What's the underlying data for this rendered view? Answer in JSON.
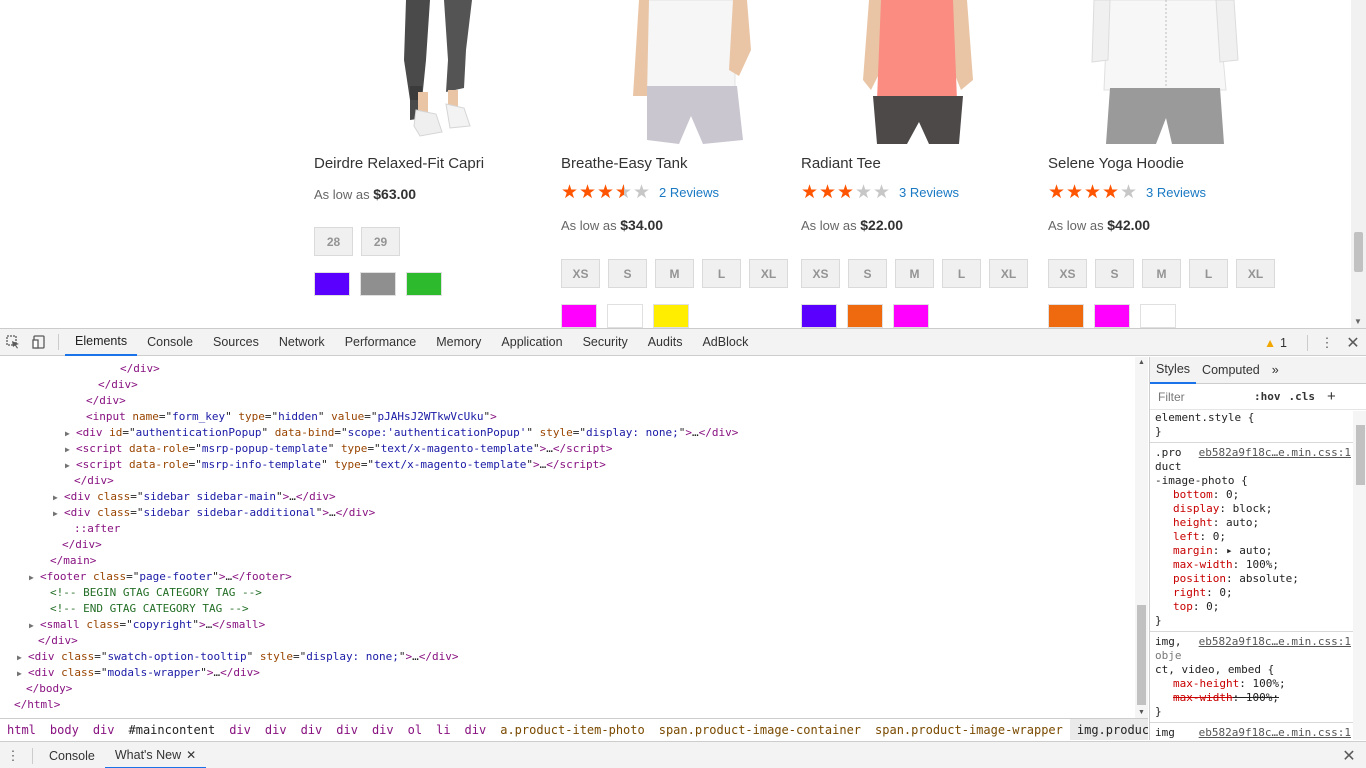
{
  "products": [
    {
      "name": "Deirdre Relaxed-Fit Capri",
      "rating": null,
      "reviews": "",
      "price_label": "As low as",
      "price": "$63.00",
      "sizes": [
        "28",
        "29"
      ],
      "colors": [
        "#5a00ff",
        "#8f8f8f",
        "#2dba2d"
      ]
    },
    {
      "name": "Breathe-Easy Tank",
      "rating": 3.5,
      "reviews": "2 Reviews",
      "price_label": "As low as",
      "price": "$34.00",
      "sizes": [
        "XS",
        "S",
        "M",
        "L",
        "XL"
      ],
      "colors": [
        "#ff00ff",
        "#ffffff",
        "#ffee00"
      ]
    },
    {
      "name": "Radiant Tee",
      "rating": 3,
      "reviews": "3 Reviews",
      "price_label": "As low as",
      "price": "$22.00",
      "sizes": [
        "XS",
        "S",
        "M",
        "L",
        "XL"
      ],
      "colors": [
        "#5a00ff",
        "#ef6a0e",
        "#ff00ff"
      ]
    },
    {
      "name": "Selene Yoga Hoodie",
      "rating": 4,
      "reviews": "3 Reviews",
      "price_label": "As low as",
      "price": "$42.00",
      "sizes": [
        "XS",
        "S",
        "M",
        "L",
        "XL"
      ],
      "colors": [
        "#ef6a0e",
        "#ff00ff",
        "#ffffff"
      ]
    }
  ],
  "devtools": {
    "tabs": [
      "Elements",
      "Console",
      "Sources",
      "Network",
      "Performance",
      "Memory",
      "Application",
      "Security",
      "Audits",
      "AdBlock"
    ],
    "active_tab": "Elements",
    "warnings": "1",
    "dom_lines": [
      {
        "indent": 120,
        "html": "<span class='tg'>&lt;/div&gt;</span>"
      },
      {
        "indent": 98,
        "html": "<span class='tg'>&lt;/div&gt;</span>"
      },
      {
        "indent": 86,
        "html": "<span class='tg'>&lt;/div&gt;</span>"
      },
      {
        "indent": 86,
        "html": "<span class='tg'>&lt;input</span> <span class='an'>name</span>=\"<span class='av'>form_key</span>\" <span class='an'>type</span>=\"<span class='av'>hidden</span>\" <span class='an'>value</span>=\"<span class='av'>pJAHsJ2WTkwVcUku</span>\"<span class='tg'>&gt;</span>"
      },
      {
        "indent": 76,
        "tri": true,
        "html": "<span class='tg'>&lt;div</span> <span class='an'>id</span>=\"<span class='av'>authenticationPopup</span>\" <span class='an'>data-bind</span>=\"<span class='av'>scope:'authenticationPopup'</span>\" <span class='an'>style</span>=\"<span class='av'>display: none;</span>\"<span class='tg'>&gt;</span>…<span class='tg'>&lt;/div&gt;</span>"
      },
      {
        "indent": 76,
        "tri": true,
        "html": "<span class='tg'>&lt;script</span> <span class='an'>data-role</span>=\"<span class='av'>msrp-popup-template</span>\" <span class='an'>type</span>=\"<span class='av'>text/x-magento-template</span>\"<span class='tg'>&gt;</span>…<span class='tg'>&lt;/script&gt;</span>"
      },
      {
        "indent": 76,
        "tri": true,
        "html": "<span class='tg'>&lt;script</span> <span class='an'>data-role</span>=\"<span class='av'>msrp-info-template</span>\" <span class='an'>type</span>=\"<span class='av'>text/x-magento-template</span>\"<span class='tg'>&gt;</span>…<span class='tg'>&lt;/script&gt;</span>"
      },
      {
        "indent": 74,
        "html": "<span class='tg'>&lt;/div&gt;</span>"
      },
      {
        "indent": 64,
        "tri": true,
        "html": "<span class='tg'>&lt;div</span> <span class='an'>class</span>=\"<span class='av'>sidebar sidebar-main</span>\"<span class='tg'>&gt;</span>…<span class='tg'>&lt;/div&gt;</span>"
      },
      {
        "indent": 64,
        "tri": true,
        "html": "<span class='tg'>&lt;div</span> <span class='an'>class</span>=\"<span class='av'>sidebar sidebar-additional</span>\"<span class='tg'>&gt;</span>…<span class='tg'>&lt;/div&gt;</span>"
      },
      {
        "indent": 74,
        "html": "<span class='ps'>::after</span>"
      },
      {
        "indent": 62,
        "html": "<span class='tg'>&lt;/div&gt;</span>"
      },
      {
        "indent": 50,
        "html": "<span class='tg'>&lt;/main&gt;</span>"
      },
      {
        "indent": 40,
        "tri": true,
        "html": "<span class='tg'>&lt;footer</span> <span class='an'>class</span>=\"<span class='av'>page-footer</span>\"<span class='tg'>&gt;</span>…<span class='tg'>&lt;/footer&gt;</span>"
      },
      {
        "indent": 50,
        "html": "<span class='cm'>&lt;!-- BEGIN GTAG CATEGORY TAG --&gt;</span>"
      },
      {
        "indent": 50,
        "html": "<span class='cm'>&lt;!-- END GTAG CATEGORY TAG --&gt;</span>"
      },
      {
        "indent": 40,
        "tri": true,
        "html": "<span class='tg'>&lt;small</span> <span class='an'>class</span>=\"<span class='av'>copyright</span>\"<span class='tg'>&gt;</span>…<span class='tg'>&lt;/small&gt;</span>"
      },
      {
        "indent": 38,
        "html": "<span class='tg'>&lt;/div&gt;</span>"
      },
      {
        "indent": 28,
        "tri": true,
        "html": "<span class='tg'>&lt;div</span> <span class='an'>class</span>=\"<span class='av'>swatch-option-tooltip</span>\" <span class='an'>style</span>=\"<span class='av'>display: none;</span>\"<span class='tg'>&gt;</span>…<span class='tg'>&lt;/div&gt;</span>"
      },
      {
        "indent": 28,
        "tri": true,
        "html": "<span class='tg'>&lt;div</span> <span class='an'>class</span>=\"<span class='av'>modals-wrapper</span>\"<span class='tg'>&gt;</span>…<span class='tg'>&lt;/div&gt;</span>"
      },
      {
        "indent": 26,
        "html": "<span class='tg'>&lt;/body&gt;</span>"
      },
      {
        "indent": 14,
        "html": "<span class='tg'>&lt;/html&gt;</span>"
      }
    ],
    "breadcrumbs": [
      {
        "text": "html",
        "kind": "tag"
      },
      {
        "text": "body",
        "kind": "tag"
      },
      {
        "text": "div",
        "kind": "tag"
      },
      {
        "text": "#maincontent",
        "kind": "plain"
      },
      {
        "text": "div",
        "kind": "tag"
      },
      {
        "text": "div",
        "kind": "tag"
      },
      {
        "text": "div",
        "kind": "tag"
      },
      {
        "text": "div",
        "kind": "tag"
      },
      {
        "text": "div",
        "kind": "tag"
      },
      {
        "text": "ol",
        "kind": "tag"
      },
      {
        "text": "li",
        "kind": "tag"
      },
      {
        "text": "div",
        "kind": "tag"
      },
      {
        "text": "a.product-item-photo",
        "kind": "cls"
      },
      {
        "text": "span.product-image-container",
        "kind": "cls"
      },
      {
        "text": "span.product-image-wrapper",
        "kind": "cls"
      },
      {
        "text": "img.product-image-photo",
        "kind": "sel"
      }
    ],
    "styles_tabs": [
      "Styles",
      "Computed"
    ],
    "filter_placeholder": "Filter",
    "hov": ":hov",
    "cls": ".cls",
    "rules": [
      {
        "t": "sel",
        "text": "element.style {"
      },
      {
        "t": "sel",
        "text": "}"
      },
      {
        "t": "sep"
      },
      {
        "t": "sel",
        "text": ".pro",
        "src": "eb582a9f18c…e.min.css:1"
      },
      {
        "t": "sel",
        "text": "duct"
      },
      {
        "t": "sel",
        "text": "-image-photo {"
      },
      {
        "t": "prop",
        "name": "bottom",
        "value": "0;"
      },
      {
        "t": "prop",
        "name": "display",
        "value": "block;"
      },
      {
        "t": "prop",
        "name": "height",
        "value": "auto;"
      },
      {
        "t": "prop",
        "name": "left",
        "value": "0;"
      },
      {
        "t": "prop",
        "name": "margin",
        "value": "▸ auto;"
      },
      {
        "t": "prop",
        "name": "max-width",
        "value": "100%;"
      },
      {
        "t": "prop",
        "name": "position",
        "value": "absolute;"
      },
      {
        "t": "prop",
        "name": "right",
        "value": "0;"
      },
      {
        "t": "prop",
        "name": "top",
        "value": "0;"
      },
      {
        "t": "sel",
        "text": "}"
      },
      {
        "t": "sep"
      },
      {
        "t": "sel",
        "text": "img,",
        "src": "eb582a9f18c…e.min.css:1"
      },
      {
        "t": "sel",
        "text": "obje",
        "dim": true
      },
      {
        "t": "sel",
        "text": "ct, video, embed {"
      },
      {
        "t": "prop",
        "name": "max-height",
        "value": "100%;"
      },
      {
        "t": "prop",
        "name": "max-width",
        "value": "100%;",
        "strike": true
      },
      {
        "t": "sel",
        "text": "}"
      },
      {
        "t": "sep"
      },
      {
        "t": "sel",
        "text": "img",
        "src": "eb582a9f18c…e.min.css:1"
      }
    ],
    "drawer_tabs": [
      "Console",
      "What's New"
    ],
    "drawer_active": "What's New"
  }
}
